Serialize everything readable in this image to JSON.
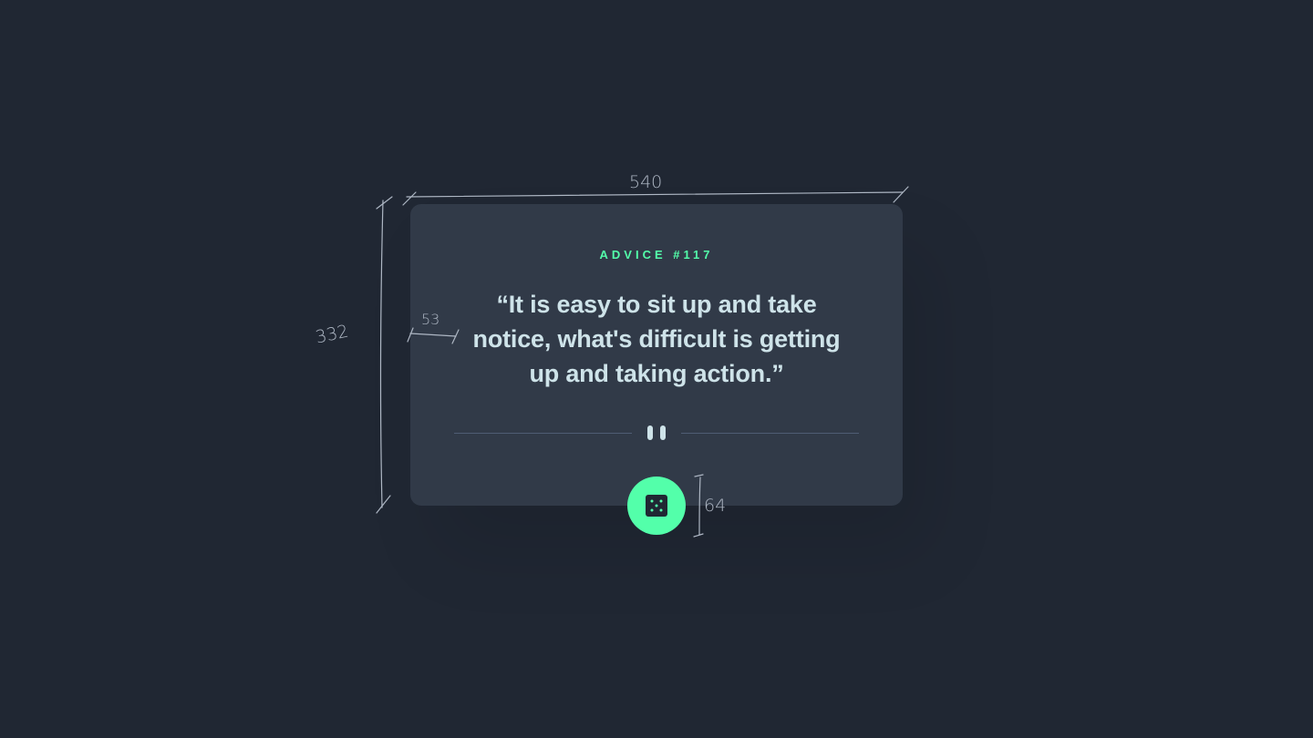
{
  "card": {
    "advice_id": "ADVICE #117",
    "quote": "“It is easy to sit up and take notice, what's difficult is getting up and taking action.”"
  },
  "divider": {
    "icon": "pause-icon"
  },
  "dice_button": {
    "icon": "dice-icon"
  },
  "annotations": {
    "width_label": "540",
    "height_label": "332",
    "padding_label": "53",
    "button_label": "64"
  },
  "colors": {
    "background": "#202733",
    "card": "#313a48",
    "accent": "#53ffaa",
    "text": "#cee3e9",
    "divider": "#4f5d74",
    "annotation": "#aeb7c4"
  }
}
